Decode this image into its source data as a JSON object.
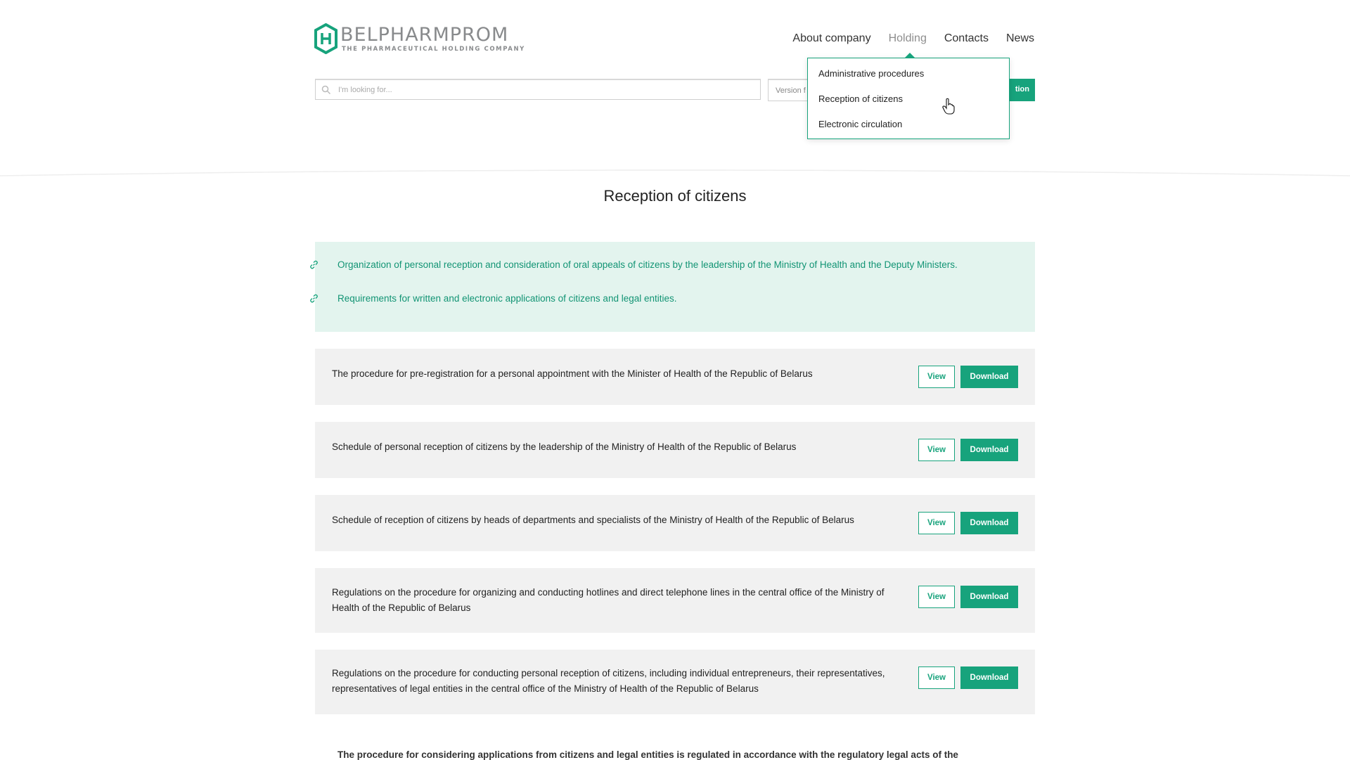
{
  "logo": {
    "name": "BELPHARMPROM",
    "tagline": "THE PHARMACEUTICAL HOLDING COMPANY"
  },
  "nav": {
    "items": [
      {
        "label": "About company"
      },
      {
        "label": "Holding"
      },
      {
        "label": "Contacts"
      },
      {
        "label": "News"
      }
    ],
    "active": "Holding"
  },
  "search": {
    "placeholder": "I'm looking for..."
  },
  "version_label": "Version f",
  "registration_label": "tion",
  "dropdown": {
    "items": [
      {
        "label": "Administrative procedures"
      },
      {
        "label": "Reception of citizens"
      },
      {
        "label": "Electronic circulation"
      }
    ]
  },
  "page_title": "Reception of citizens",
  "links": [
    {
      "text": "Organization of personal reception and consideration of oral appeals of citizens by the leadership of the Ministry of Health and the Deputy Ministers.",
      "icon": "link-icon"
    },
    {
      "text": "Requirements for written and electronic applications of citizens and legal entities.",
      "icon": "link-icon"
    }
  ],
  "documents": [
    {
      "text": "The procedure for pre-registration for a personal appointment with the Minister of Health of the Republic of Belarus",
      "view": "View",
      "download": "Download"
    },
    {
      "text": "Schedule of personal reception of citizens by the leadership of the Ministry of Health of the Republic of Belarus",
      "view": "View",
      "download": "Download"
    },
    {
      "text": "Schedule of reception of citizens by heads of departments and specialists of the Ministry of Health of the Republic of Belarus",
      "view": "View",
      "download": "Download"
    },
    {
      "text": "Regulations on the procedure for organizing and conducting hotlines and direct telephone lines in the central office of the Ministry of Health of the Republic of Belarus",
      "view": "View",
      "download": "Download"
    },
    {
      "text": "Regulations on the procedure for conducting personal reception of citizens, including individual entrepreneurs, their representatives, representatives of legal entities in the central office of the Ministry of Health of the Republic of Belarus",
      "view": "View",
      "download": "Download"
    }
  ],
  "footer_note": "The procedure for considering applications from citizens and legal entities is regulated in accordance with the regulatory legal acts of the",
  "colors": {
    "accent": "#17a37c",
    "link_bg": "#e3f4ee",
    "row_bg": "#f1f1f1",
    "link_text": "#129474"
  }
}
